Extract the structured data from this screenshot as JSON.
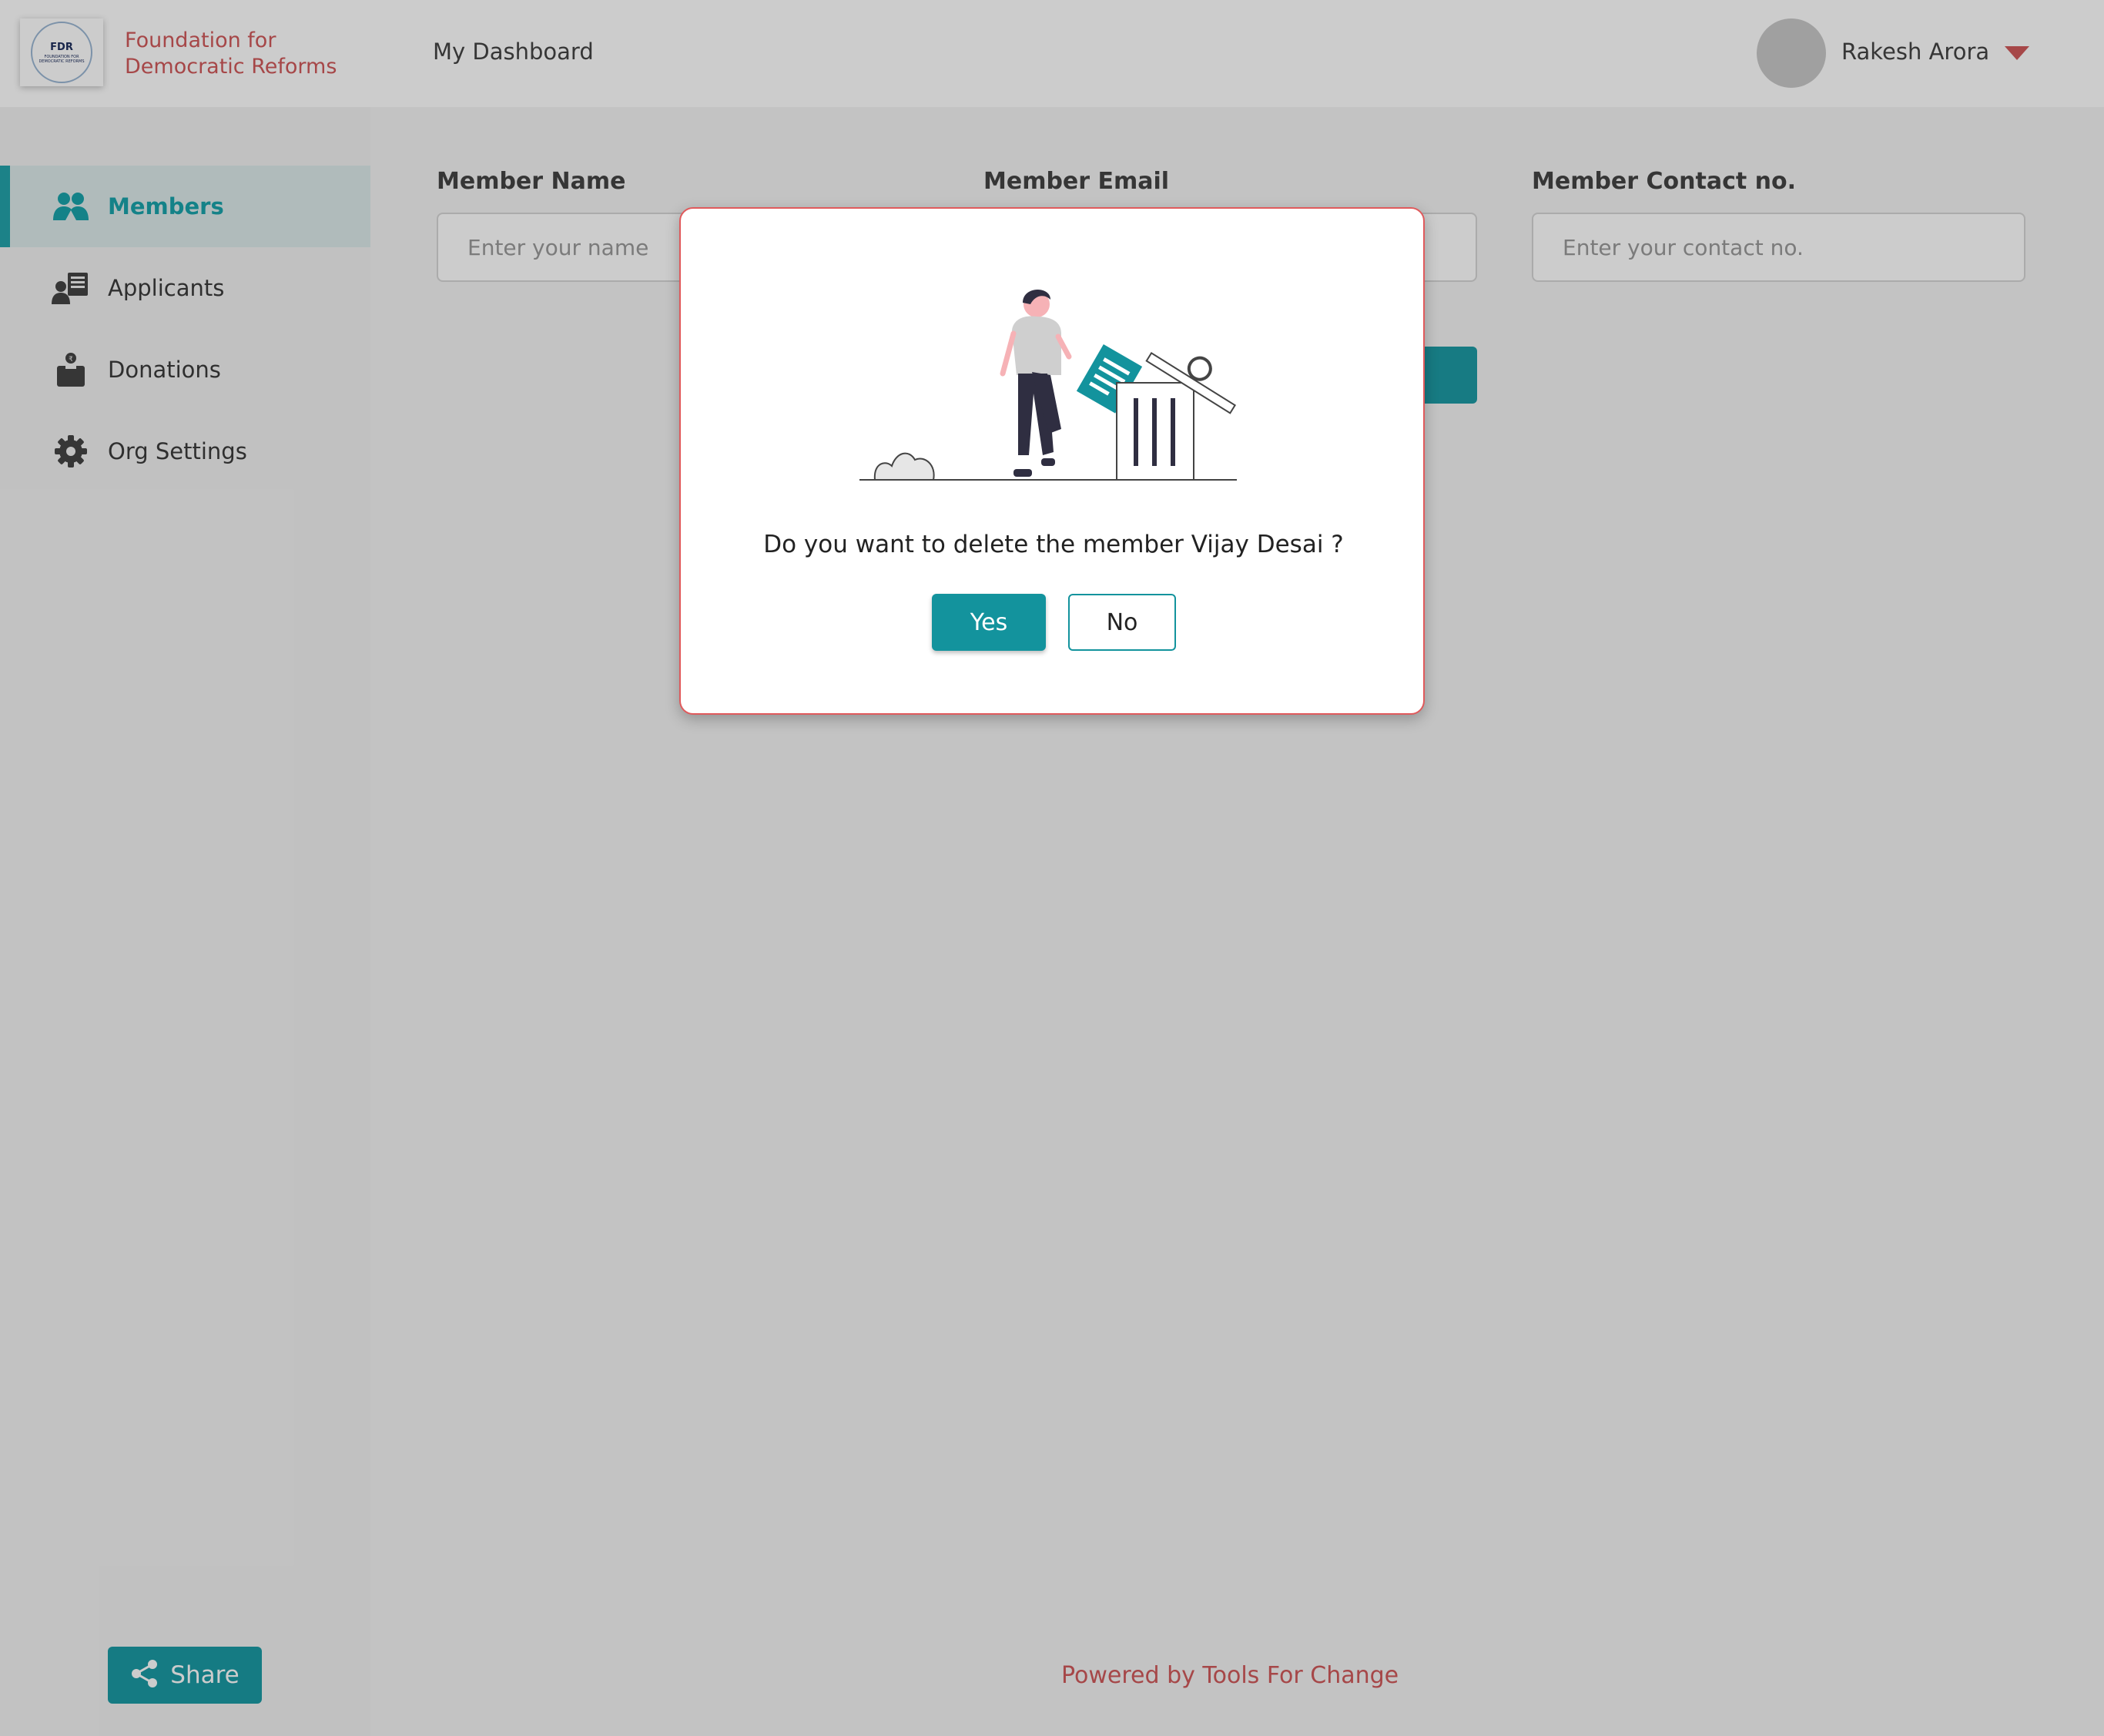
{
  "brand": {
    "logo_abbr": "FDR",
    "logo_subtext": "FOUNDATION FOR DEMOCRATIC REFORMS",
    "name": "Foundation for Democratic Reforms"
  },
  "sidebar": {
    "items": [
      {
        "label": "Members",
        "icon": "members-icon",
        "active": true
      },
      {
        "label": "Applicants",
        "icon": "applicants-icon",
        "active": false
      },
      {
        "label": "Donations",
        "icon": "donations-icon",
        "active": false
      },
      {
        "label": "Org Settings",
        "icon": "gear-icon",
        "active": false
      }
    ],
    "share_label": "Share"
  },
  "header": {
    "title": "My Dashboard",
    "user_name": "Rakesh Arora"
  },
  "form": {
    "name_label": "Member Name",
    "name_placeholder": "Enter your name",
    "email_label": "Member Email",
    "contact_label": "Member Contact no.",
    "contact_placeholder": "Enter your contact no."
  },
  "footer": {
    "text": "Powered by Tools For Change"
  },
  "modal": {
    "message": "Do you want to delete the member Vijay Desai ?",
    "yes_label": "Yes",
    "no_label": "No"
  },
  "colors": {
    "accent": "#1aa3ab",
    "brand_red": "#d0595b",
    "modal_border": "#e05a5c"
  }
}
